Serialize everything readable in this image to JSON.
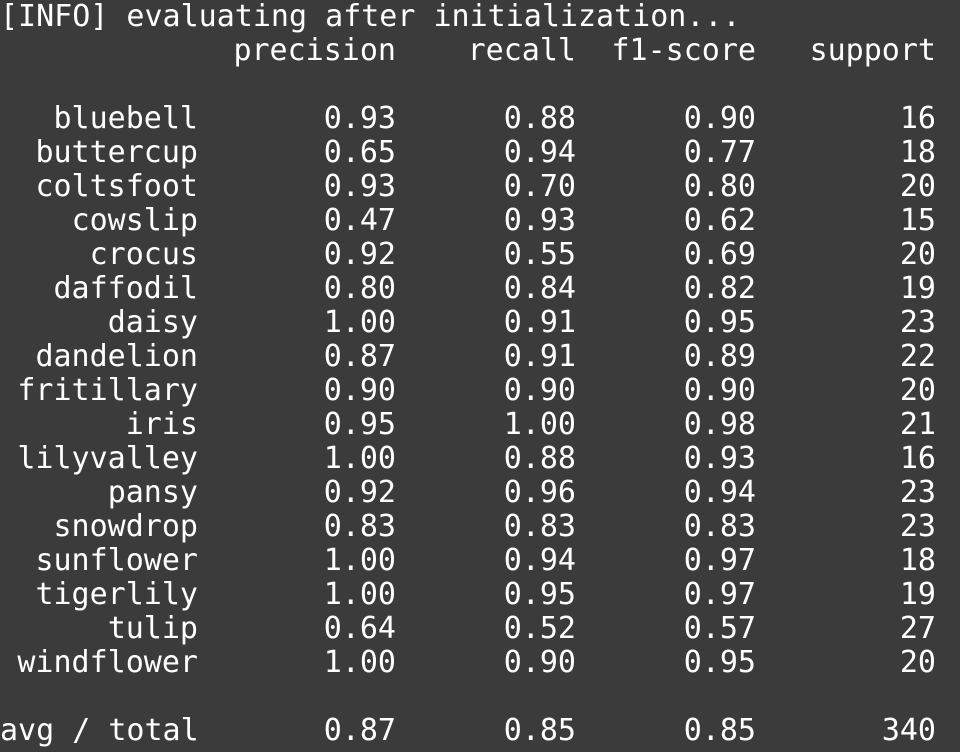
{
  "terminal": {
    "info_line": "[INFO] evaluating after initialization...",
    "headers": {
      "precision": "precision",
      "recall": "recall",
      "f1": "f1-score",
      "support": "support"
    },
    "rows": [
      {
        "label": "bluebell",
        "precision": "0.93",
        "recall": "0.88",
        "f1": "0.90",
        "support": "16"
      },
      {
        "label": "buttercup",
        "precision": "0.65",
        "recall": "0.94",
        "f1": "0.77",
        "support": "18"
      },
      {
        "label": "coltsfoot",
        "precision": "0.93",
        "recall": "0.70",
        "f1": "0.80",
        "support": "20"
      },
      {
        "label": "cowslip",
        "precision": "0.47",
        "recall": "0.93",
        "f1": "0.62",
        "support": "15"
      },
      {
        "label": "crocus",
        "precision": "0.92",
        "recall": "0.55",
        "f1": "0.69",
        "support": "20"
      },
      {
        "label": "daffodil",
        "precision": "0.80",
        "recall": "0.84",
        "f1": "0.82",
        "support": "19"
      },
      {
        "label": "daisy",
        "precision": "1.00",
        "recall": "0.91",
        "f1": "0.95",
        "support": "23"
      },
      {
        "label": "dandelion",
        "precision": "0.87",
        "recall": "0.91",
        "f1": "0.89",
        "support": "22"
      },
      {
        "label": "fritillary",
        "precision": "0.90",
        "recall": "0.90",
        "f1": "0.90",
        "support": "20"
      },
      {
        "label": "iris",
        "precision": "0.95",
        "recall": "1.00",
        "f1": "0.98",
        "support": "21"
      },
      {
        "label": "lilyvalley",
        "precision": "1.00",
        "recall": "0.88",
        "f1": "0.93",
        "support": "16"
      },
      {
        "label": "pansy",
        "precision": "0.92",
        "recall": "0.96",
        "f1": "0.94",
        "support": "23"
      },
      {
        "label": "snowdrop",
        "precision": "0.83",
        "recall": "0.83",
        "f1": "0.83",
        "support": "23"
      },
      {
        "label": "sunflower",
        "precision": "1.00",
        "recall": "0.94",
        "f1": "0.97",
        "support": "18"
      },
      {
        "label": "tigerlily",
        "precision": "1.00",
        "recall": "0.95",
        "f1": "0.97",
        "support": "19"
      },
      {
        "label": "tulip",
        "precision": "0.64",
        "recall": "0.52",
        "f1": "0.57",
        "support": "27"
      },
      {
        "label": "windflower",
        "precision": "1.00",
        "recall": "0.90",
        "f1": "0.95",
        "support": "20"
      }
    ],
    "total": {
      "label": "avg / total",
      "precision": "0.87",
      "recall": "0.85",
      "f1": "0.85",
      "support": "340"
    }
  }
}
